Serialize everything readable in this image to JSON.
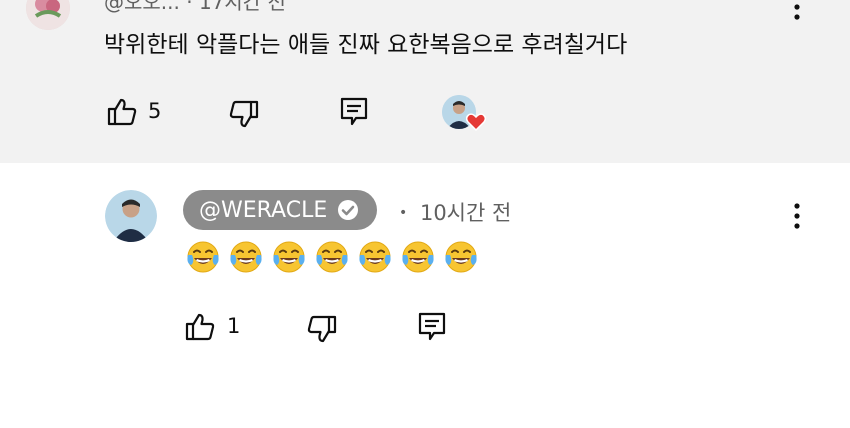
{
  "colors": {
    "top_comment_bg": "#f2f2f2",
    "handle_chip_bg": "#8b8b8b",
    "heart": "#e53935",
    "icon_stroke": "#0f0f0f",
    "meta_text": "#606060"
  },
  "comment_1": {
    "header_partial": "@오오...  ·  17시간 전",
    "text": "박위한테 악플다는 애들 진짜 요한복음으로 후려칠거다",
    "like_count": "5",
    "liked_by_creator": true,
    "icons": [
      "like-icon",
      "dislike-icon",
      "reply-icon",
      "more-vert-icon"
    ]
  },
  "comment_2": {
    "handle": "@WERACLE",
    "verified": true,
    "separator": "•",
    "timestamp": "10시간 전",
    "emoji": [
      "😂",
      "😂",
      "😂",
      "😂",
      "😂",
      "😂",
      "😂"
    ],
    "like_count": "1",
    "icons": [
      "like-icon",
      "dislike-icon",
      "reply-icon",
      "more-vert-icon"
    ]
  }
}
